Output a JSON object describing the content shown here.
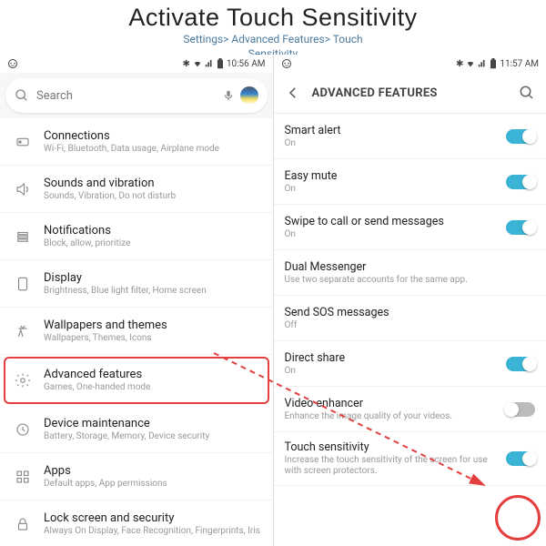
{
  "header": {
    "title": "Activate Touch Sensitivity",
    "breadcrumb_l1": "Settings> Advanced Features> Touch",
    "breadcrumb_l2": "Sensitivity"
  },
  "left": {
    "status": {
      "time": "10:56 AM"
    },
    "search": {
      "placeholder": "Search"
    },
    "items": [
      {
        "title": "Connections",
        "sub": "Wi-Fi, Bluetooth, Data usage, Airplane mode"
      },
      {
        "title": "Sounds and vibration",
        "sub": "Sounds, Vibration, Do not disturb"
      },
      {
        "title": "Notifications",
        "sub": "Block, allow, prioritize"
      },
      {
        "title": "Display",
        "sub": "Brightness, Blue light filter, Home screen"
      },
      {
        "title": "Wallpapers and themes",
        "sub": "Wallpapers, Themes, Icons"
      },
      {
        "title": "Advanced features",
        "sub": "Games, One-handed mode"
      },
      {
        "title": "Device maintenance",
        "sub": "Battery, Storage, Memory, Device security"
      },
      {
        "title": "Apps",
        "sub": "Default apps, App permissions"
      },
      {
        "title": "Lock screen and security",
        "sub": "Always On Display, Face Recognition, Fingerprints, Iris"
      }
    ]
  },
  "right": {
    "status": {
      "time": "11:57 AM"
    },
    "page_title": "ADVANCED FEATURES",
    "items": [
      {
        "title": "Smart alert",
        "sub": "On",
        "toggle": "on"
      },
      {
        "title": "Easy mute",
        "sub": "On",
        "toggle": "on"
      },
      {
        "title": "Swipe to call or send messages",
        "sub": "On",
        "toggle": "on"
      },
      {
        "title": "Dual Messenger",
        "sub": "Use two separate accounts for the same app.",
        "toggle": null
      },
      {
        "title": "Send SOS messages",
        "sub": "Off",
        "toggle": null
      },
      {
        "title": "Direct share",
        "sub": "On",
        "toggle": "on"
      },
      {
        "title": "Video enhancer",
        "sub": "Enhance the image quality of your videos.",
        "toggle": "off"
      },
      {
        "title": "Touch sensitivity",
        "sub": "Increase the touch sensitivity of the screen for use with screen protectors.",
        "toggle": "on"
      }
    ]
  }
}
